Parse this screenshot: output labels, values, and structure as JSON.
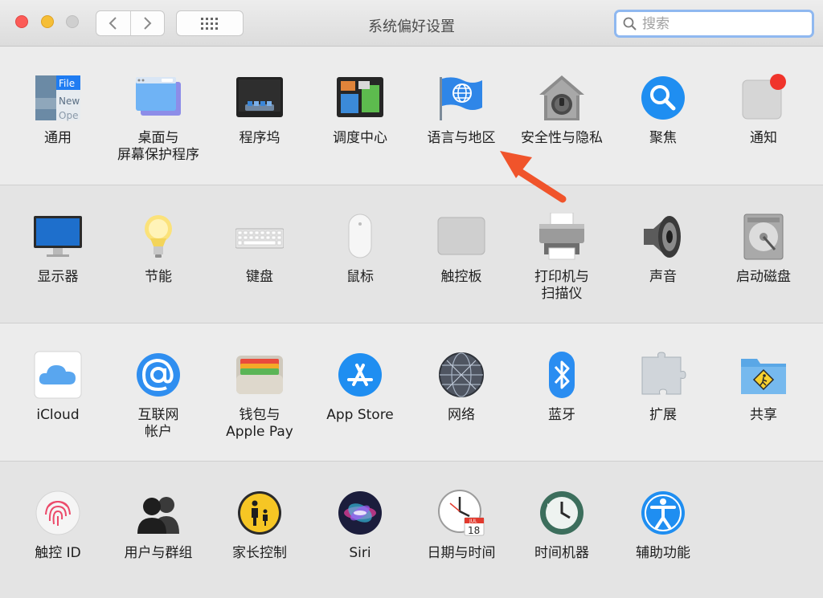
{
  "window": {
    "title": "系统偏好设置"
  },
  "search": {
    "placeholder": "搜索"
  },
  "rows": [
    [
      {
        "label": "通用",
        "icon": "general-icon"
      },
      {
        "label": "桌面与\n屏幕保护程序",
        "icon": "desktop-screensaver-icon"
      },
      {
        "label": "程序坞",
        "icon": "dock-icon"
      },
      {
        "label": "调度中心",
        "icon": "mission-control-icon"
      },
      {
        "label": "语言与地区",
        "icon": "language-region-icon"
      },
      {
        "label": "安全性与隐私",
        "icon": "security-privacy-icon"
      },
      {
        "label": "聚焦",
        "icon": "spotlight-icon"
      },
      {
        "label": "通知",
        "icon": "notifications-icon"
      }
    ],
    [
      {
        "label": "显示器",
        "icon": "displays-icon"
      },
      {
        "label": "节能",
        "icon": "energy-saver-icon"
      },
      {
        "label": "键盘",
        "icon": "keyboard-icon"
      },
      {
        "label": "鼠标",
        "icon": "mouse-icon"
      },
      {
        "label": "触控板",
        "icon": "trackpad-icon"
      },
      {
        "label": "打印机与\n扫描仪",
        "icon": "printers-scanners-icon"
      },
      {
        "label": "声音",
        "icon": "sound-icon"
      },
      {
        "label": "启动磁盘",
        "icon": "startup-disk-icon"
      }
    ],
    [
      {
        "label": "iCloud",
        "icon": "icloud-icon"
      },
      {
        "label": "互联网\n帐户",
        "icon": "internet-accounts-icon"
      },
      {
        "label": "钱包与\nApple Pay",
        "icon": "wallet-applepay-icon"
      },
      {
        "label": "App Store",
        "icon": "app-store-icon"
      },
      {
        "label": "网络",
        "icon": "network-icon"
      },
      {
        "label": "蓝牙",
        "icon": "bluetooth-icon"
      },
      {
        "label": "扩展",
        "icon": "extensions-icon"
      },
      {
        "label": "共享",
        "icon": "sharing-icon"
      }
    ],
    [
      {
        "label": "触控 ID",
        "icon": "touch-id-icon"
      },
      {
        "label": "用户与群组",
        "icon": "users-groups-icon"
      },
      {
        "label": "家长控制",
        "icon": "parental-controls-icon"
      },
      {
        "label": "Siri",
        "icon": "siri-icon"
      },
      {
        "label": "日期与时间",
        "icon": "date-time-icon"
      },
      {
        "label": "时间机器",
        "icon": "time-machine-icon"
      },
      {
        "label": "辅助功能",
        "icon": "accessibility-icon"
      }
    ]
  ],
  "icon_text": {
    "general_file": "File",
    "general_new": "New",
    "general_open": "Ope",
    "calendar_month": "JUL",
    "calendar_day": "18"
  },
  "colors": {
    "accent_blue": "#1f7cf2",
    "annotation_arrow": "#f0542b"
  }
}
